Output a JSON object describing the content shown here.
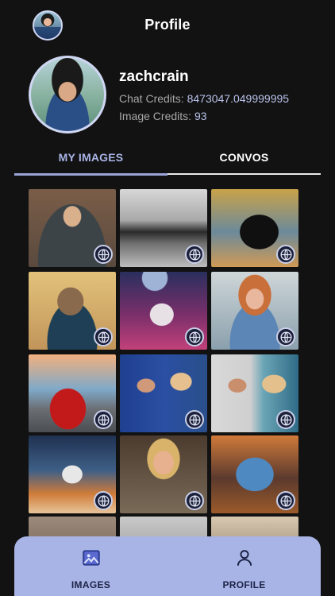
{
  "header": {
    "title": "Profile"
  },
  "profile": {
    "username": "zachcrain",
    "chat_credits_label": "Chat Credits:",
    "chat_credits_value": "8473047.049999995",
    "image_credits_label": "Image Credits:",
    "image_credits_value": "93"
  },
  "tabs": [
    {
      "label": "MY IMAGES",
      "active": true
    },
    {
      "label": "CONVOS",
      "active": false
    }
  ],
  "images": [
    {
      "subject": "hoodie portrait"
    },
    {
      "subject": "muscle car"
    },
    {
      "subject": "black panther"
    },
    {
      "subject": "monkey in suit"
    },
    {
      "subject": "astronaut in flowers"
    },
    {
      "subject": "woman in denim jacket"
    },
    {
      "subject": "red sports car"
    },
    {
      "subject": "football player with singer"
    },
    {
      "subject": "football player with singer 2"
    },
    {
      "subject": "astronaut on rocks"
    },
    {
      "subject": "woman with headset"
    },
    {
      "subject": "blue dragon"
    },
    {
      "subject": "partial image"
    },
    {
      "subject": "partial image"
    },
    {
      "subject": "partial image"
    }
  ],
  "bottom_nav": [
    {
      "label": "IMAGES",
      "icon": "image-icon"
    },
    {
      "label": "PROFILE",
      "icon": "person-icon"
    }
  ],
  "colors": {
    "background": "#121212",
    "accent": "#a9b4e6",
    "credit_value": "#b9c2ea"
  }
}
